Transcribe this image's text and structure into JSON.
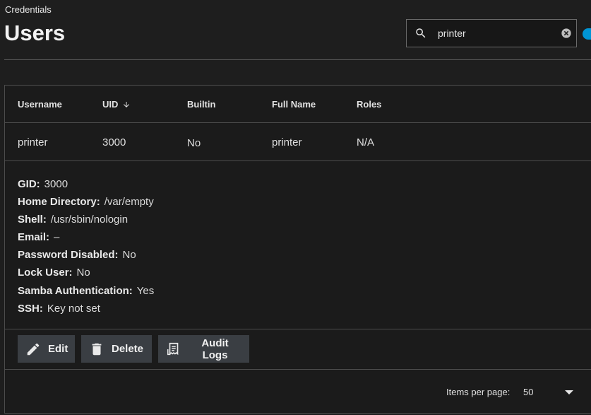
{
  "breadcrumb": "Credentials",
  "page_title": "Users",
  "search": {
    "value": "printer",
    "icon": "search-icon",
    "clear_icon": "clear-circle-icon"
  },
  "accent_color": "#0095d5",
  "table": {
    "columns": [
      "Username",
      "UID",
      "Builtin",
      "Full Name",
      "Roles"
    ],
    "sort_column": "UID",
    "sort_direction": "descending",
    "rows": [
      {
        "username": "printer",
        "uid": "3000",
        "builtin": "No",
        "full_name": "printer",
        "roles": "N/A"
      }
    ]
  },
  "details": [
    {
      "label": "GID:",
      "value": "3000"
    },
    {
      "label": "Home Directory:",
      "value": "/var/empty"
    },
    {
      "label": "Shell:",
      "value": "/usr/sbin/nologin"
    },
    {
      "label": "Email:",
      "value": "–"
    },
    {
      "label": "Password Disabled:",
      "value": "No"
    },
    {
      "label": "Lock User:",
      "value": "No"
    },
    {
      "label": "Samba Authentication:",
      "value": "Yes"
    },
    {
      "label": "SSH:",
      "value": "Key not set"
    }
  ],
  "actions": {
    "edit": "Edit",
    "delete": "Delete",
    "audit_logs": "Audit Logs"
  },
  "paginator": {
    "label": "Items per page:",
    "value": "50"
  }
}
